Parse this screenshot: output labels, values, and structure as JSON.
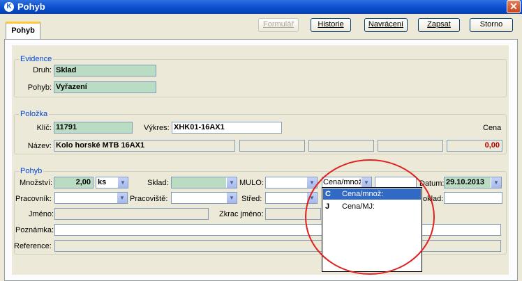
{
  "window": {
    "title": "Pohyb",
    "close_label": "✕",
    "app_icon": "K"
  },
  "tabs": [
    {
      "label": "Pohyb"
    }
  ],
  "toolbar": {
    "formular": "Formulář",
    "historie": "Historie",
    "navraceni": "Navrácení",
    "zapsat": "Zapsat",
    "storno": "Storno"
  },
  "evidence": {
    "legend": "Evidence",
    "druh_label": "Druh:",
    "druh_value": "Sklad",
    "pohyb_label": "Pohyb:",
    "pohyb_value": "Vyřazení"
  },
  "polozka": {
    "legend": "Položka",
    "klic_label": "Klíč:",
    "klic_value": "11791",
    "vykres_label": "Výkres:",
    "vykres_value": "XHK01-16AX1",
    "cena_label": "Cena",
    "nazev_label": "Název:",
    "nazev_value": "Kolo horské MTB 16AX1",
    "cena_value": "0,00"
  },
  "pohyb": {
    "legend": "Pohyb",
    "mnozstvi_label": "Množství:",
    "mnozstvi_value": "2,00",
    "unit_value": "ks",
    "sklad_label": "Sklad:",
    "mulo_label": "MULO:",
    "cena_combo_value": "Cena/množ:",
    "datum_label": "Datum:",
    "datum_value": "29.10.2013",
    "pracovnik_label": "Pracovník:",
    "pracoviste_label": "Pracoviště:",
    "stred_label": "Střed:",
    "doklad_label": "oklad:",
    "jmeno_label": "Jméno:",
    "zkrac_label": "Zkrac jméno:",
    "poznamka_label": "Poznámka:",
    "reference_label": "Reference:"
  },
  "dropdown_options": [
    {
      "code": "C",
      "text": "Cena/množ:",
      "selected": true
    },
    {
      "code": "J",
      "text": "Cena/MJ:",
      "selected": false
    }
  ],
  "colors": {
    "highlight_circle": "#e02020",
    "accent": "#0046d5"
  }
}
